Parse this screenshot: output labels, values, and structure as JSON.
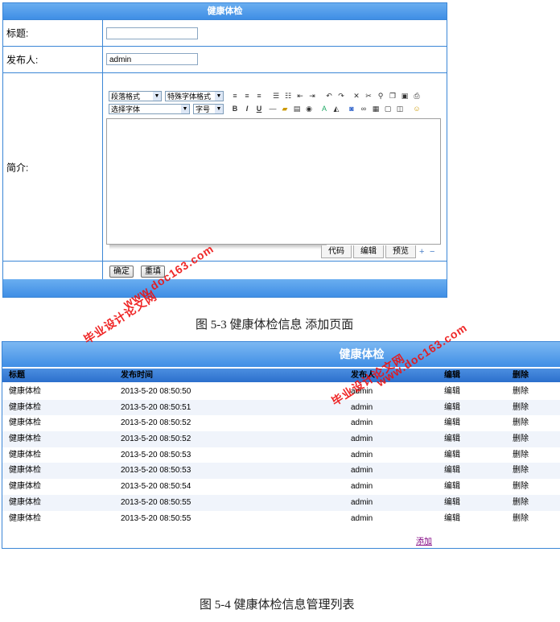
{
  "form": {
    "title": "健康体检",
    "title_label": "标题:",
    "title_value": "",
    "publisher_label": "发布人:",
    "publisher_value": "admin",
    "intro_label": "简介:",
    "editor": {
      "paragraph_format": "段落格式",
      "special_font": "特殊字体格式",
      "select_font": "选择字体",
      "font_size": "字号",
      "tab_code": "代码",
      "tab_edit": "编辑",
      "tab_preview": "预览",
      "plus": "+",
      "minus": "−"
    },
    "confirm_button": "确定",
    "reset_button": "重填"
  },
  "caption_top": "图 5-3 健康体检信息 添加页面",
  "list": {
    "title": "健康体检",
    "headers": [
      "标题",
      "发布时间",
      "发布人",
      "编辑",
      "删除"
    ],
    "rows": [
      [
        "健康体检",
        "2013-5-20 08:50:50",
        "admin",
        "编辑",
        "删除"
      ],
      [
        "健康体检",
        "2013-5-20 08:50:51",
        "admin",
        "编辑",
        "删除"
      ],
      [
        "健康体检",
        "2013-5-20 08:50:52",
        "admin",
        "编辑",
        "删除"
      ],
      [
        "健康体检",
        "2013-5-20 08:50:52",
        "admin",
        "编辑",
        "删除"
      ],
      [
        "健康体检",
        "2013-5-20 08:50:53",
        "admin",
        "编辑",
        "删除"
      ],
      [
        "健康体检",
        "2013-5-20 08:50:53",
        "admin",
        "编辑",
        "删除"
      ],
      [
        "健康体检",
        "2013-5-20 08:50:54",
        "admin",
        "编辑",
        "删除"
      ],
      [
        "健康体检",
        "2013-5-20 08:50:55",
        "admin",
        "编辑",
        "删除"
      ],
      [
        "健康体检",
        "2013-5-20 08:50:55",
        "admin",
        "编辑",
        "删除"
      ]
    ],
    "add_link": "添加"
  },
  "caption_bottom": "图 5-4 健康体检信息管理列表",
  "watermark": {
    "site": "www.doc163.com",
    "brand": "毕业设计论文网"
  }
}
